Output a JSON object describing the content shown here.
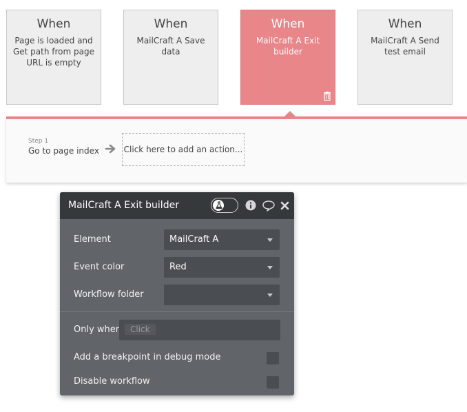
{
  "events": [
    {
      "when": "When",
      "desc": "Page is loaded and Get path from page URL is empty",
      "active": false
    },
    {
      "when": "When",
      "desc": "MailCraft A Save data",
      "active": false
    },
    {
      "when": "When",
      "desc": "MailCraft A Exit builder",
      "active": true
    },
    {
      "when": "When",
      "desc": "MailCraft A Send test email",
      "active": false
    }
  ],
  "actions": {
    "step_label": "Step 1",
    "step_name": "Go to page index",
    "add_action": "Click here to add an action..."
  },
  "panel": {
    "title": "MailCraft A Exit builder",
    "icons": [
      "flask-icon",
      "info-icon",
      "comment-icon",
      "close-icon"
    ],
    "element_label": "Element",
    "element_value": "MailCraft A",
    "event_color_label": "Event color",
    "event_color_value": "Red",
    "workflow_folder_label": "Workflow folder",
    "workflow_folder_value": "",
    "only_when_label": "Only when",
    "only_when_placeholder": "Click",
    "breakpoint_label": "Add a breakpoint in debug mode",
    "disable_label": "Disable workflow"
  },
  "colors": {
    "active_event": "#e8868a",
    "panel_bg": "#616468",
    "panel_header": "#36393c"
  }
}
